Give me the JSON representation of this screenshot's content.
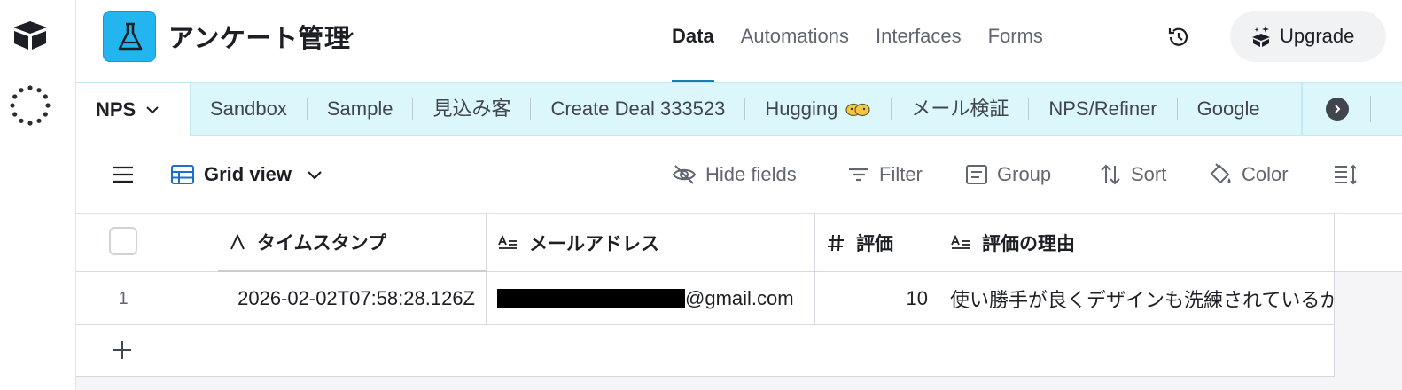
{
  "base": {
    "name": "アンケート管理"
  },
  "nav": {
    "items": [
      {
        "label": "Data",
        "active": true
      },
      {
        "label": "Automations",
        "active": false
      },
      {
        "label": "Interfaces",
        "active": false
      },
      {
        "label": "Forms",
        "active": false
      }
    ],
    "upgrade_label": "Upgrade"
  },
  "tabs": {
    "active": "NPS",
    "items": [
      "Sandbox",
      "Sample",
      "見込み客",
      "Create Deal 333523",
      "Hugging",
      "メール検証",
      "NPS/Refiner",
      "Google"
    ]
  },
  "toolbar": {
    "view_name": "Grid view",
    "hide_fields": "Hide fields",
    "filter": "Filter",
    "group": "Group",
    "sort": "Sort",
    "color": "Color"
  },
  "grid": {
    "columns": [
      {
        "label": "タイムスタンプ",
        "type_icon": "text-a-icon"
      },
      {
        "label": "メールアドレス",
        "type_icon": "long-text-icon"
      },
      {
        "label": "評価",
        "type_icon": "number-icon"
      },
      {
        "label": "評価の理由",
        "type_icon": "long-text-icon"
      }
    ],
    "rows": [
      {
        "number": "1",
        "timestamp": "2026-02-02T07:58:28.126Z",
        "email_suffix": "@gmail.com",
        "rating": "10",
        "reason": "使い勝手が良くデザインも洗練されているから"
      }
    ]
  },
  "colors": {
    "accent": "#1283b0",
    "base_icon": "#22b5f0",
    "tab_bar": "#dbf7fc"
  }
}
